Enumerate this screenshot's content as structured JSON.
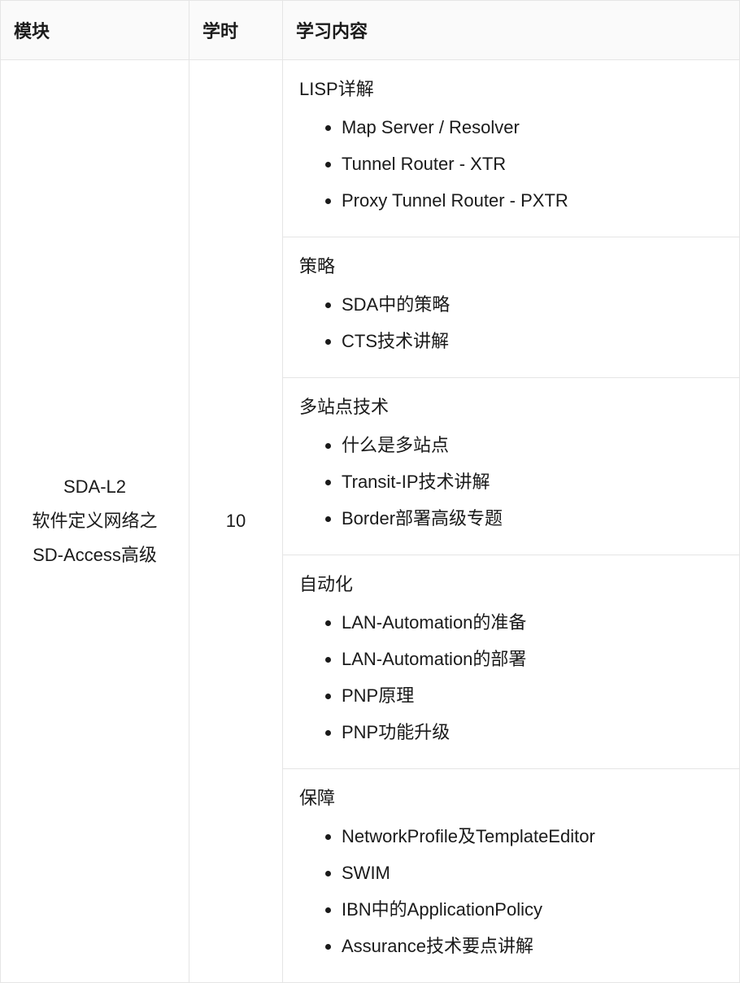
{
  "headers": {
    "module": "模块",
    "hours": "学时",
    "content": "学习内容"
  },
  "row": {
    "module_lines": [
      "SDA-L2",
      "软件定义网络之",
      "SD-Access高级"
    ],
    "hours": "10",
    "sections": [
      {
        "title": "LISP详解",
        "items": [
          "Map Server / Resolver",
          "Tunnel Router - XTR",
          "Proxy Tunnel Router - PXTR"
        ]
      },
      {
        "title": "策略",
        "items": [
          "SDA中的策略",
          "CTS技术讲解"
        ]
      },
      {
        "title": "多站点技术",
        "items": [
          "什么是多站点",
          "Transit-IP技术讲解",
          "Border部署高级专题"
        ]
      },
      {
        "title": "自动化",
        "items": [
          "LAN-Automation的准备",
          "LAN-Automation的部署",
          "PNP原理",
          "PNP功能升级"
        ]
      },
      {
        "title": "保障",
        "items": [
          "NetworkProfile及TemplateEditor",
          "SWIM",
          "IBN中的ApplicationPolicy",
          "Assurance技术要点讲解"
        ]
      }
    ]
  }
}
